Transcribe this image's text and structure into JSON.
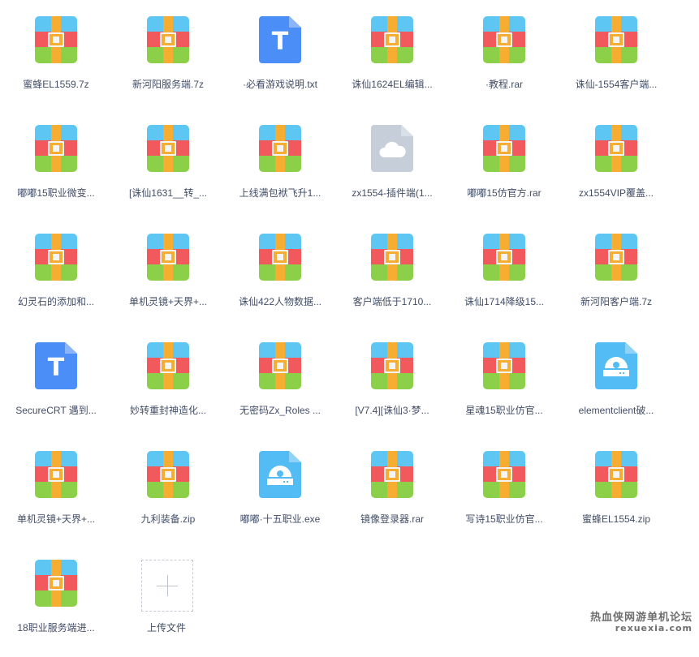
{
  "colors": {
    "zip_top": "#5ec6f3",
    "zip_mid": "#f2595d",
    "zip_bot": "#8ccf48",
    "zip_strap": "#f7ad31",
    "txt_doc": "#4c8ef7",
    "cloud_doc": "#c5ced9",
    "exe_doc": "#54bcf4",
    "label_text": "#424e67"
  },
  "files": [
    {
      "name": "蜜蜂EL1559.7z",
      "icon": "archive-icon"
    },
    {
      "name": "新河阳服务端.7z",
      "icon": "archive-icon"
    },
    {
      "name": "·必看游戏说明.txt",
      "icon": "text-file-icon"
    },
    {
      "name": "诛仙1624EL编辑...",
      "icon": "archive-icon"
    },
    {
      "name": "·教程.rar",
      "icon": "archive-icon"
    },
    {
      "name": "诛仙-1554客户端...",
      "icon": "archive-icon"
    },
    {
      "name": "嘟嘟15职业微变...",
      "icon": "archive-icon"
    },
    {
      "name": "[诛仙1631__转_...",
      "icon": "archive-icon"
    },
    {
      "name": "上线满包袱飞升1...",
      "icon": "archive-icon"
    },
    {
      "name": "zx1554-插件端(1...",
      "icon": "cloud-file-icon"
    },
    {
      "name": "嘟嘟15仿官方.rar",
      "icon": "archive-icon"
    },
    {
      "name": "zx1554VIP覆盖...",
      "icon": "archive-icon"
    },
    {
      "name": "幻灵石的添加和...",
      "icon": "archive-icon"
    },
    {
      "name": "单机灵镜+天界+...",
      "icon": "archive-icon"
    },
    {
      "name": "诛仙422人物数据...",
      "icon": "archive-icon"
    },
    {
      "name": "客户端低于1710...",
      "icon": "archive-icon"
    },
    {
      "name": "诛仙1714降级15...",
      "icon": "archive-icon"
    },
    {
      "name": "新河阳客户端.7z",
      "icon": "archive-icon"
    },
    {
      "name": "SecureCRT 遇到...",
      "icon": "text-file-icon"
    },
    {
      "name": "妙转重封神造化...",
      "icon": "archive-icon"
    },
    {
      "name": "无密码Zx_Roles ...",
      "icon": "archive-icon"
    },
    {
      "name": "[V7.4][诛仙3·梦...",
      "icon": "archive-icon"
    },
    {
      "name": "星魂15职业仿官...",
      "icon": "archive-icon"
    },
    {
      "name": "elementclient破...",
      "icon": "executable-file-icon"
    },
    {
      "name": "单机灵镜+天界+...",
      "icon": "archive-icon"
    },
    {
      "name": "九利装备.zip",
      "icon": "archive-icon"
    },
    {
      "name": "嘟嘟·十五职业.exe",
      "icon": "executable-file-icon"
    },
    {
      "name": "镜像登录器.rar",
      "icon": "archive-icon"
    },
    {
      "name": "写诗15职业仿官...",
      "icon": "archive-icon"
    },
    {
      "name": "蜜蜂EL1554.zip",
      "icon": "archive-icon"
    },
    {
      "name": "18职业服务端进...",
      "icon": "archive-icon"
    }
  ],
  "upload": {
    "label": "上传文件",
    "icon": "plus-icon"
  },
  "watermark": {
    "line1": "热血侠网游单机论坛",
    "line2": "rexuexia.com"
  }
}
